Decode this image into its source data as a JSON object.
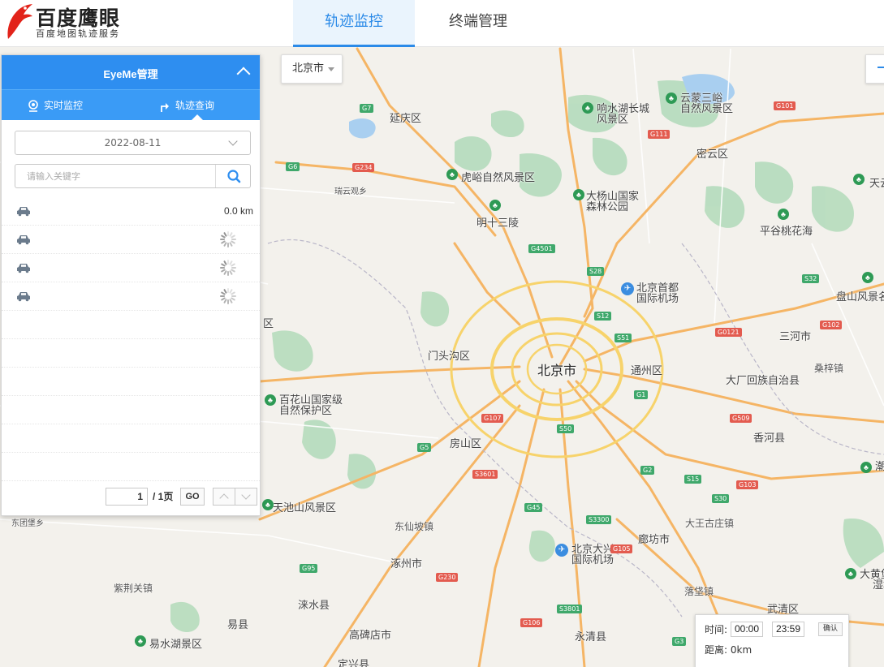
{
  "header": {
    "logo_title": "百度鹰眼",
    "logo_subtitle": "百度地图轨迹服务",
    "nav": {
      "track_monitor": "轨迹监控",
      "terminal_manage": "终端管理"
    }
  },
  "map": {
    "city_select": "北京市",
    "labels": {
      "beijing": "北京市",
      "yanqing": "延庆区",
      "miyun": "密云区",
      "pinggu": "平谷桃花海",
      "huairou": "虎峪自然风景区",
      "ming_tombs": "明十三陵",
      "dayang_1": "大杨山国家",
      "dayang_2": "森林公园",
      "xiangshui_1": "响水湖长城",
      "xiangshui_2": "风景区",
      "yunmeng_1": "云蒙三峪",
      "yunmeng_2": "自然风景区",
      "ruiyun": "瑞云观乡",
      "airport_1": "北京首都",
      "airport_2": "国际机场",
      "mentougou": "门头沟区",
      "tongzhou": "通州区",
      "sanhe": "三河市",
      "dachang": "大厂回族自治县",
      "sangzi": "桑梓镇",
      "baihua_1": "百花山国家级",
      "baihua_2": "自然保护区",
      "fangshan": "房山区",
      "xianghe": "香河县",
      "tianchi": "天池山风景区",
      "dongxian": "东仙坡镇",
      "zhuozhou": "涿州市",
      "daxing_1": "北京大兴",
      "daxing_2": "国际机场",
      "langfang": "廊坊市",
      "dawang": "大王古庄镇",
      "luodian": "落垡镇",
      "wuqing": "武清区",
      "zijing": "紫荆关镇",
      "laishui": "涞水县",
      "yixian": "易县",
      "gaobeidian": "高碑店市",
      "yongqing": "永清县",
      "yishui": "易水湖景区",
      "dingxing": "定兴县",
      "dongtuan": "东团堡乡",
      "panshan": "盘山风景名",
      "tianyun": "天云",
      "dahuangbao_1": "大黄堡",
      "dahuangbao_2": "湿地",
      "chao": "潮",
      "qu": "区"
    },
    "roads": [
      "G7",
      "G6",
      "G234",
      "G101",
      "G111",
      "G4501",
      "S28",
      "S32",
      "S12",
      "S51",
      "G0121",
      "G102",
      "G1",
      "G107",
      "S50",
      "G5",
      "G509",
      "S3601",
      "G230",
      "S3300",
      "G2",
      "S15",
      "S30",
      "G103",
      "G45",
      "G105",
      "G95",
      "S3801",
      "G106",
      "G3"
    ]
  },
  "panel": {
    "title": "EyeMe管理",
    "tabs": {
      "realtime": "实时监控",
      "query": "轨迹查询"
    },
    "date": "2022-08-11",
    "search_placeholder": "请输入关键字",
    "vehicles": [
      {
        "distance": "0.0 km",
        "loading": false
      },
      {
        "distance": "",
        "loading": true
      },
      {
        "distance": "",
        "loading": true
      },
      {
        "distance": "",
        "loading": true
      }
    ],
    "pager": {
      "current": "1",
      "total": "/ 1页",
      "go": "GO"
    }
  },
  "time_filter": {
    "time_label": "时间:",
    "start": "00:00",
    "end": "23:59",
    "confirm": "确认",
    "distance_label": "距离:",
    "distance_value": "0km"
  },
  "colors": {
    "primary": "#2e8ef0",
    "tab_active_text": "#2b8ae8",
    "map_bg": "#f3f1ec",
    "road_highway": "#f5b565",
    "road_ring": "#f7d36b",
    "park": "#b8dcbf"
  }
}
